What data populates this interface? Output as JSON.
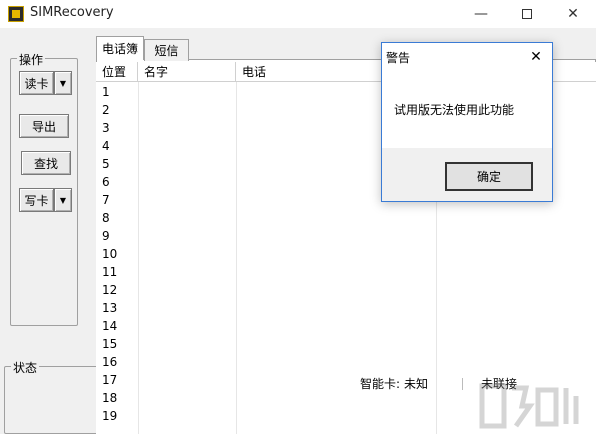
{
  "window": {
    "title": "SIMRecovery",
    "icon": "app-icon",
    "minimize": "—",
    "close": "✕"
  },
  "operations": {
    "title": "操作",
    "read_card": "读卡",
    "export": "导出",
    "find": "查找",
    "write_card": "写卡",
    "dropdown_arrow": "▼"
  },
  "status": {
    "title": "状态"
  },
  "tabs": [
    {
      "label": "电话簿",
      "active": true
    },
    {
      "label": "短信",
      "active": false
    }
  ],
  "table": {
    "columns": [
      "位置",
      "名字",
      "电话"
    ],
    "rows": [
      "1",
      "2",
      "3",
      "4",
      "5",
      "6",
      "7",
      "8",
      "9",
      "10",
      "11",
      "12",
      "13",
      "14",
      "15",
      "16",
      "17",
      "18",
      "19"
    ]
  },
  "statusbar": {
    "smart_card_label": "智能卡:",
    "smart_card_value": "未知",
    "link_status": "未联接"
  },
  "dialog": {
    "title": "警告",
    "message": "试用版无法使用此功能",
    "ok_label": "确定",
    "close": "✕"
  }
}
